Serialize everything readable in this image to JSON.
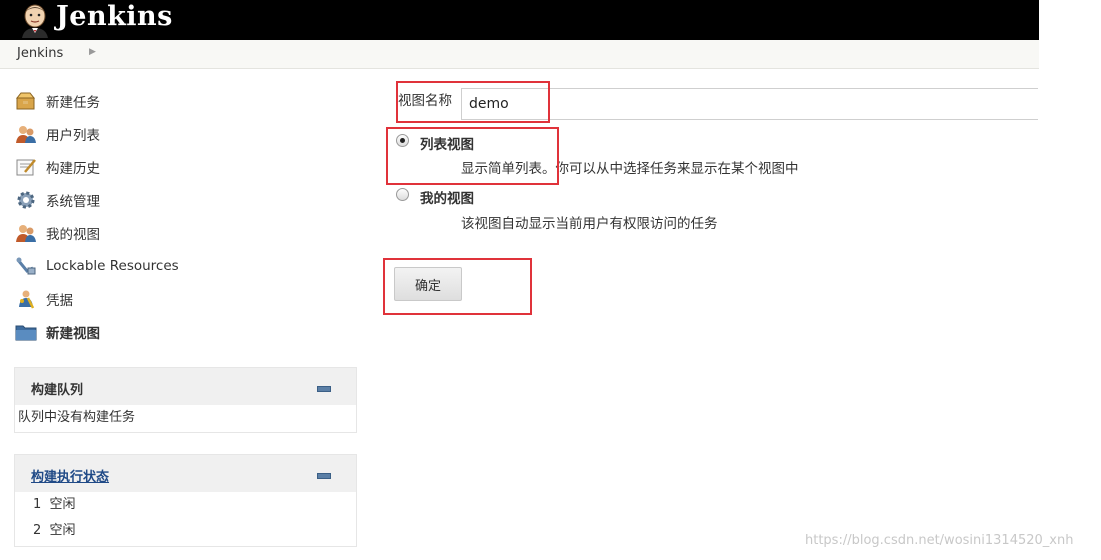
{
  "header": {
    "brand": "Jenkins",
    "logo_icon": "jenkins-butler-icon"
  },
  "breadcrumb": {
    "items": [
      "Jenkins"
    ]
  },
  "sidebar": {
    "tasks": [
      {
        "label": "新建任务",
        "icon": "new-item-icon"
      },
      {
        "label": "用户列表",
        "icon": "users-icon"
      },
      {
        "label": "构建历史",
        "icon": "build-history-icon"
      },
      {
        "label": "系统管理",
        "icon": "gear-icon"
      },
      {
        "label": "我的视图",
        "icon": "my-views-icon"
      },
      {
        "label": "Lockable Resources",
        "icon": "lockable-resources-icon"
      },
      {
        "label": "凭据",
        "icon": "credentials-icon"
      },
      {
        "label": "新建视图",
        "icon": "folder-icon"
      }
    ],
    "build_queue": {
      "title": "构建队列",
      "empty_text": "队列中没有构建任务"
    },
    "executors": {
      "title": "构建执行状态",
      "rows": [
        {
          "num": "1",
          "status": "空闲"
        },
        {
          "num": "2",
          "status": "空闲"
        }
      ]
    }
  },
  "form": {
    "name_label": "视图名称",
    "name_value": "demo",
    "options": [
      {
        "label": "列表视图",
        "desc": "显示简单列表。你可以从中选择任务来显示在某个视图中",
        "checked": true
      },
      {
        "label": "我的视图",
        "desc": "该视图自动显示当前用户有权限访问的任务",
        "checked": false
      }
    ],
    "ok_label": "确定"
  },
  "watermark": "https://blog.csdn.net/wosini1314520_xnh",
  "colors": {
    "topbar": "#000000",
    "highlight": "#e0323a",
    "pane_header": "#f0f0f0"
  }
}
